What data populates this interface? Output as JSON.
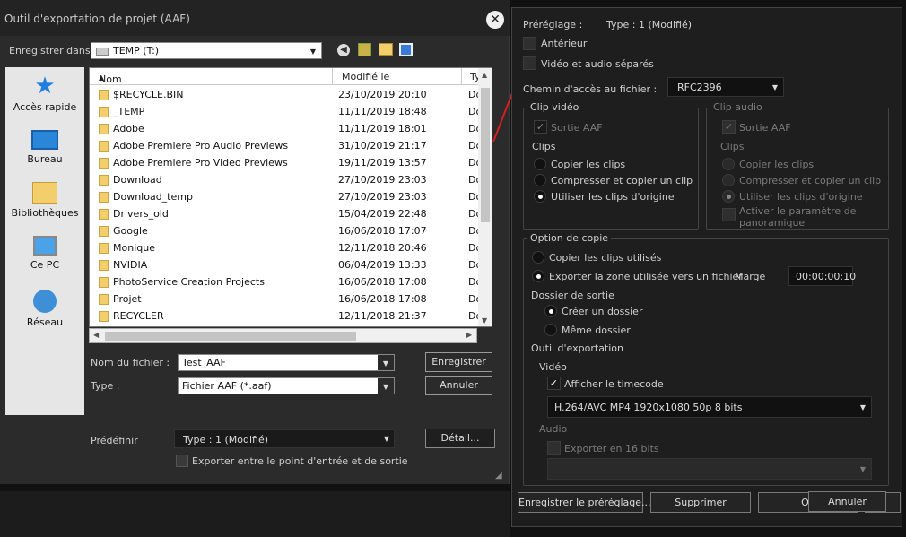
{
  "export_dialog": {
    "title": "Outil d'exportation de projet (AAF)",
    "save_in_label": "Enregistrer dans :",
    "save_in_value": "TEMP (T:)",
    "places": [
      "Accès rapide",
      "Bureau",
      "Bibliothèques",
      "Ce PC",
      "Réseau"
    ],
    "columns": {
      "name": "Nom",
      "modified": "Modifié le",
      "type": "Ty"
    },
    "files": [
      {
        "name": "$RECYCLE.BIN",
        "date": "23/10/2019 20:10",
        "type": "Do"
      },
      {
        "name": "_TEMP",
        "date": "11/11/2019 18:48",
        "type": "Do"
      },
      {
        "name": "Adobe",
        "date": "11/11/2019 18:01",
        "type": "Do"
      },
      {
        "name": "Adobe Premiere Pro Audio Previews",
        "date": "31/10/2019 21:17",
        "type": "Do"
      },
      {
        "name": "Adobe Premiere Pro Video Previews",
        "date": "19/11/2019 13:57",
        "type": "Do"
      },
      {
        "name": "Download",
        "date": "27/10/2019 23:03",
        "type": "Do"
      },
      {
        "name": "Download_temp",
        "date": "27/10/2019 23:03",
        "type": "Do"
      },
      {
        "name": "Drivers_old",
        "date": "15/04/2019 22:48",
        "type": "Do"
      },
      {
        "name": "Google",
        "date": "16/06/2018 17:07",
        "type": "Do"
      },
      {
        "name": "Monique",
        "date": "12/11/2018 20:46",
        "type": "Do"
      },
      {
        "name": "NVIDIA",
        "date": "06/04/2019 13:33",
        "type": "Do"
      },
      {
        "name": "PhotoService Creation Projects",
        "date": "16/06/2018 17:08",
        "type": "Do"
      },
      {
        "name": "Projet",
        "date": "16/06/2018 17:08",
        "type": "Do"
      },
      {
        "name": "RECYCLER",
        "date": "12/11/2018 21:37",
        "type": "Do"
      }
    ],
    "filename_label": "Nom du fichier :",
    "filename_value": "Test_AAF",
    "type_label": "Type :",
    "type_value": "Fichier AAF (*.aaf)",
    "save_button": "Enregistrer",
    "cancel_button": "Annuler",
    "preset_label": "Prédéfinir",
    "preset_value": "Type : 1 (Modifié)",
    "detail_button": "Détail...",
    "export_between_label": "Exporter entre le point d'entrée et de sortie"
  },
  "detail_panel": {
    "preset_label": "Préréglage :",
    "preset_value": "Type : 1 (Modifié)",
    "previous_label": "Antérieur",
    "separate_av_label": "Vidéo et audio séparés",
    "file_path_label": "Chemin d'accès au fichier :",
    "file_path_value": "RFC2396",
    "video_clip": {
      "title": "Clip vidéo",
      "aaf_output": "Sortie AAF",
      "clips_label": "Clips",
      "options": [
        "Copier les clips",
        "Compresser et copier un clip",
        "Utiliser les clips d'origine"
      ]
    },
    "audio_clip": {
      "title": "Clip audio",
      "aaf_output": "Sortie AAF",
      "clips_label": "Clips",
      "options": [
        "Copier les clips",
        "Compresser et copier un clip",
        "Utiliser les clips d'origine"
      ],
      "pan_label_1": "Activer le paramètre de",
      "pan_label_2": "panoramique"
    },
    "copy_option": {
      "title": "Option de copie",
      "copy_used": "Copier les clips utilisés",
      "export_used_zone": "Exporter la zone utilisée vers un fichier",
      "margin_label": "Marge",
      "margin_value": "00:00:00:10",
      "output_folder_label": "Dossier de sortie",
      "create_folder": "Créer un dossier",
      "same_folder": "Même dossier",
      "export_tool_label": "Outil d'exportation",
      "video_label": "Vidéo",
      "show_timecode": "Afficher le timecode",
      "video_format": "H.264/AVC MP4 1920x1080 50p 8 bits",
      "audio_label": "Audio",
      "export_16bit": "Exporter en 16 bits",
      "audio_format": ""
    },
    "save_preset_button": "Enregistrer le préréglage...",
    "delete_button": "Supprimer",
    "ok_button": "OK",
    "cancel_button": "Annuler"
  }
}
